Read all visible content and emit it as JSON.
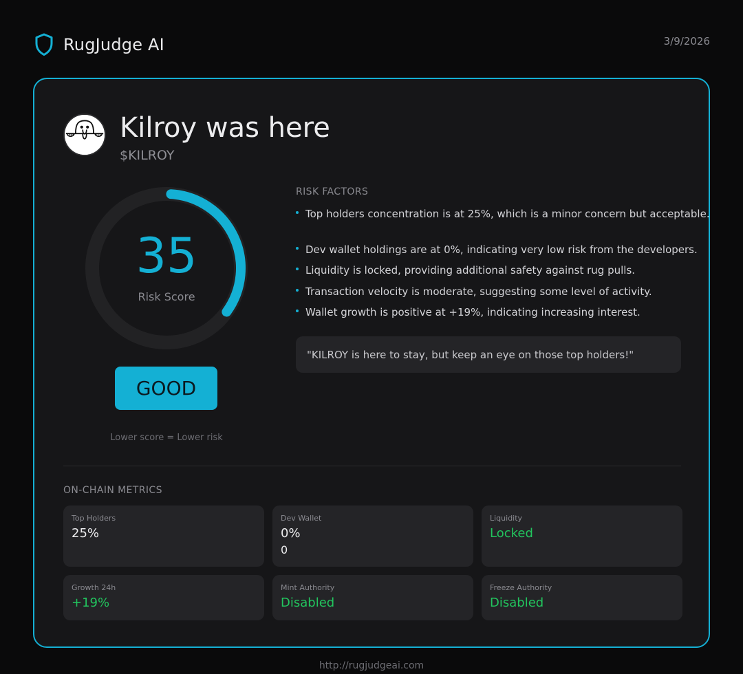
{
  "header": {
    "brand_name": "RugJudge AI",
    "brand_icon": "shield-icon",
    "date": "3/9/2026"
  },
  "token": {
    "name": "Kilroy was here",
    "symbol": "$KILROY",
    "avatar_icon": "kilroy-avatar"
  },
  "score": {
    "value": "35",
    "fraction": 0.35,
    "label": "Risk Score",
    "verdict": "GOOD",
    "note": "Lower score = Lower risk"
  },
  "risk_factors": {
    "title": "RISK FACTORS",
    "items": [
      "Top holders concentration is at 25%, which is a minor concern but acceptable.",
      "Dev wallet holdings are at 0%, indicating very low risk from the developers.",
      "Liquidity is locked, providing additional safety against rug pulls.",
      "Transaction velocity is moderate, suggesting some level of activity.",
      "Wallet growth is positive at +19%, indicating increasing interest."
    ],
    "quote": "\"KILROY is here to stay, but keep an eye on those top holders!\""
  },
  "metrics": {
    "title": "ON-CHAIN METRICS",
    "items": [
      {
        "label": "Top Holders",
        "value": "25%",
        "sub": ""
      },
      {
        "label": "Dev Wallet",
        "value": "0%",
        "sub": "0"
      },
      {
        "label": "Liquidity",
        "value": "Locked",
        "sub": ""
      },
      {
        "label": "Growth 24h",
        "value": "+19%",
        "sub": ""
      },
      {
        "label": "Mint Authority",
        "value": "Disabled",
        "sub": ""
      },
      {
        "label": "Freeze Authority",
        "value": "Disabled",
        "sub": ""
      }
    ]
  },
  "colors": {
    "accent": "#14b0d4",
    "positive": "#22c55e",
    "background": "#0a0a0b",
    "card": "#161618"
  },
  "footer": {
    "url": "http://rugjudgeai.com"
  }
}
